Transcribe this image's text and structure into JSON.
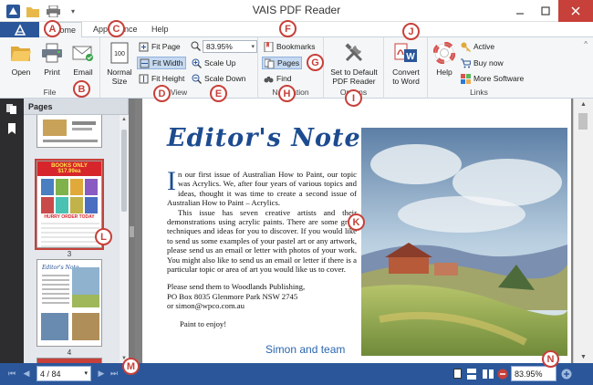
{
  "window": {
    "title": "VAIS PDF Reader"
  },
  "tabs": {
    "home": "Home",
    "appearance": "Appearance",
    "help": "Help"
  },
  "ribbon": {
    "file": {
      "label": "File",
      "open": "Open",
      "print": "Print",
      "email": "Email"
    },
    "view": {
      "label": "View",
      "normal_size_1": "Normal",
      "normal_size_2": "Size",
      "fit_page": "Fit Page",
      "fit_width": "Fit Width",
      "fit_height": "Fit Height",
      "zoom": "83.95%",
      "scale_up": "Scale Up",
      "scale_down": "Scale Down"
    },
    "navigation": {
      "label": "Navigation",
      "bookmarks": "Bookmarks",
      "pages": "Pages",
      "find": "Find"
    },
    "options": {
      "label": "Options",
      "set_default_1": "Set to Default",
      "set_default_2": "PDF Reader"
    },
    "convert": {
      "convert_1": "Convert",
      "convert_2": "to Word"
    },
    "links": {
      "label": "Links",
      "help": "Help",
      "active": "Active",
      "buy_now": "Buy now",
      "more_software": "More Software"
    }
  },
  "sidebar": {
    "pages_title": "Pages",
    "thumb_numbers": [
      "3",
      "4"
    ],
    "banner_text": "BOOKS ONLY $17.99ea",
    "order_text": "HURRY ORDER TODAY"
  },
  "document": {
    "title": "Editor's Note",
    "dropcap": "I",
    "para1": "n our first issue of Australian How to Paint, our topic was Acrylics. We, after four years of various topics and ideas, thought it was time to create a second issue of Australian How to Paint – Acrylics.",
    "para2": "This issue has seven creative artists and their demonstrations using acrylic paints. There are some great techniques and ideas for you to discover. If you would like to send us some examples of your pastel art or any artwork, please send us an email or letter with photos of your work. You might also like to send us an email or letter if there is a particular topic or area of art you would like us to cover.",
    "addr1": "Please send them to Woodlands Publishing,",
    "addr2": "PO Box 8035 Glenmore Park NSW 2745",
    "addr3": "or simon@wpco.com.au",
    "closing": "Paint to enjoy!",
    "signature": "Simon and team"
  },
  "statusbar": {
    "page": "4 / 84",
    "zoom": "83.95%"
  },
  "markers": {
    "A": "A",
    "B": "B",
    "C": "C",
    "D": "D",
    "E": "E",
    "F": "F",
    "G": "G",
    "H": "H",
    "I": "I",
    "J": "J",
    "K": "K",
    "L": "L",
    "M": "M",
    "N": "N"
  },
  "colors": {
    "accent": "#2b579a",
    "marker": "#c7403a",
    "title_blue": "#1d4b8f"
  }
}
